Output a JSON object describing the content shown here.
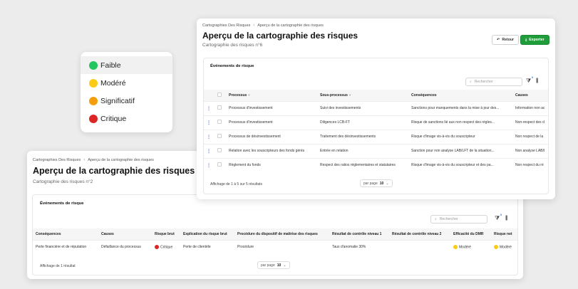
{
  "legend": {
    "items": [
      {
        "label": "Faible",
        "color": "#22c55e"
      },
      {
        "label": "Modéré",
        "color": "#facc15"
      },
      {
        "label": "Significatif",
        "color": "#f59e0b"
      },
      {
        "label": "Critique",
        "color": "#dc2626"
      }
    ]
  },
  "front": {
    "breadcrumb": {
      "parent": "Cartographies Des Risques",
      "current": "Aperçu de la cartographie des risques"
    },
    "title": "Aperçu de la cartographie des risques",
    "subtitle": "Cartographie des risques n°6",
    "buttons": {
      "return_label": "Retour",
      "export_label": "Exporter"
    },
    "section_title": "Événements de risque",
    "search_placeholder": "Rechercher",
    "filter_count": "0",
    "columns": [
      "Processus",
      "Sous-processus",
      "Conséquences",
      "Causes"
    ],
    "rows": [
      {
        "processus": "Processus d'investissement",
        "sous_processus": "Suivi des investissements",
        "consequences": "Sanctions pour manquements dans la mise à jour des...",
        "causes": "Information non ac"
      },
      {
        "processus": "Processus d'investissement",
        "sous_processus": "Diligences LCB-FT",
        "consequences": "Risque de sanctions lié aux non respect des règles...",
        "causes": "Non-respect des d"
      },
      {
        "processus": "Processus de désinvestissement",
        "sous_processus": "Traitement des désinvestissements",
        "consequences": "Risque d'image vis-à-vis du souscripteur",
        "causes": "Non respect de la"
      },
      {
        "processus": "Relation avec les souscripteurs des fonds gérés",
        "sous_processus": "Entrée en relation",
        "consequences": "Sanction pour non analyse LAB/LFT de la situation...",
        "causes": "Non analyse LAB/I"
      },
      {
        "processus": "Règlement du fonds",
        "sous_processus": "Respect des ratios réglementaires et statutaires",
        "consequences": "Risque d'image vis-à-vis du souscripteur et des pa...",
        "causes": "Non respect du rè"
      }
    ],
    "footer": {
      "summary": "Affichage de 1 à 5 sur 5 résultats",
      "per_page_label": "par page",
      "per_page_value": "10"
    }
  },
  "back": {
    "breadcrumb": {
      "parent": "Cartographies Des Risques",
      "current": "Aperçu de la cartographie des risques"
    },
    "title": "Aperçu de la cartographie des risques",
    "subtitle": "Cartographie des risques n°2",
    "section_title": "Événements de risque",
    "search_placeholder": "Rechercher",
    "filter_count": "0",
    "columns": [
      "Conséquences",
      "Causes",
      "Risque brut",
      "Explication du risque brut",
      "Procédure du dispositif de maîtrise des risques",
      "Résultat de contrôle niveau 1",
      "Résultat de contrôle niveau 2",
      "Efficacité du DMR",
      "Risque net"
    ],
    "rows": [
      {
        "consequences": "Perte financière et de réputation",
        "causes": "Défaillance du processus",
        "risque_brut": "Critique",
        "risque_brut_color": "#dc2626",
        "explication": "Perte de clientèle",
        "procedure": "Procédure",
        "controle1": "Taux d'anomalie 30%",
        "controle2": "",
        "efficacite": "Modéré",
        "efficacite_color": "#facc15",
        "risque_net": "Modéré",
        "risque_net_color": "#facc15"
      }
    ],
    "footer": {
      "summary": "Affichage de 1 résultat",
      "per_page_label": "par page",
      "per_page_value": "10"
    }
  }
}
